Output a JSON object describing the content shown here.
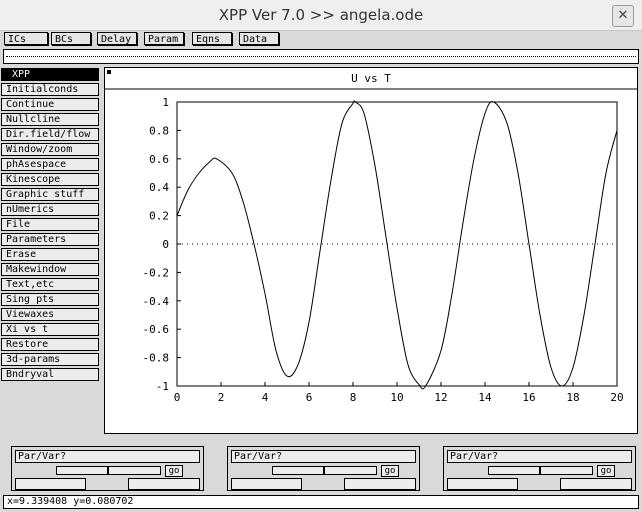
{
  "window": {
    "title": "XPP Ver 7.0 >> angela.ode",
    "close_glyph": "✕"
  },
  "toolbar": [
    "ICs",
    "BCs",
    "Delay",
    "Param",
    "Eqns",
    "Data"
  ],
  "menu": {
    "header": "XPP",
    "items": [
      "Initialconds",
      "Continue",
      "Nullcline",
      "Dir.field/flow",
      "Window/zoom",
      "phAsespace",
      "Kinescope",
      "Graphic stuff",
      "nUmerics",
      "File",
      "Parameters",
      "Erase",
      "Makewindow",
      "Text,etc",
      "Sing pts",
      "Viewaxes",
      "Xi vs t",
      "Restore",
      "3d-params",
      "Bndryval"
    ]
  },
  "panels": [
    {
      "field": "Par/Var?",
      "go": "go"
    },
    {
      "field": "Par/Var?",
      "go": "go"
    },
    {
      "field": "Par/Var?",
      "go": "go"
    }
  ],
  "status": "x=9.339408 y=0.080702",
  "chart_data": {
    "type": "line",
    "title": "U vs T",
    "xlabel": "",
    "ylabel": "",
    "xlim": [
      0,
      20
    ],
    "ylim": [
      -1,
      1
    ],
    "xticks": [
      "0",
      "2",
      "4",
      "6",
      "8",
      "10",
      "12",
      "14",
      "16",
      "18",
      "20"
    ],
    "yticks": [
      "-1",
      "-0.8",
      "-0.6",
      "-0.4",
      "-0.2",
      "0",
      "0.2",
      "0.4",
      "0.6",
      "0.8",
      "1"
    ],
    "zero_line": "dotted",
    "series": [
      {
        "x": [
          0,
          0.5,
          1,
          1.5,
          1.8,
          2.5,
          3,
          3.5,
          4,
          4.5,
          5,
          5.5,
          6,
          6.5,
          7,
          7.5,
          8,
          8.1,
          8.5,
          9,
          9.5,
          10,
          10.5,
          11,
          11.3,
          12,
          12.5,
          13,
          13.5,
          14,
          14.4,
          15,
          15.5,
          16,
          16.5,
          17,
          17.5,
          18,
          18.5,
          19,
          19.5,
          20
        ],
        "y": [
          0.2,
          0.38,
          0.5,
          0.58,
          0.6,
          0.5,
          0.3,
          0.0,
          -0.35,
          -0.75,
          -0.93,
          -0.85,
          -0.55,
          -0.05,
          0.45,
          0.85,
          0.99,
          1.0,
          0.92,
          0.55,
          0.05,
          -0.45,
          -0.85,
          -0.99,
          -1.0,
          -0.75,
          -0.35,
          0.15,
          0.6,
          0.92,
          1.0,
          0.85,
          0.5,
          0.0,
          -0.5,
          -0.87,
          -1.0,
          -0.87,
          -0.5,
          0.0,
          0.5,
          0.8
        ]
      }
    ]
  }
}
